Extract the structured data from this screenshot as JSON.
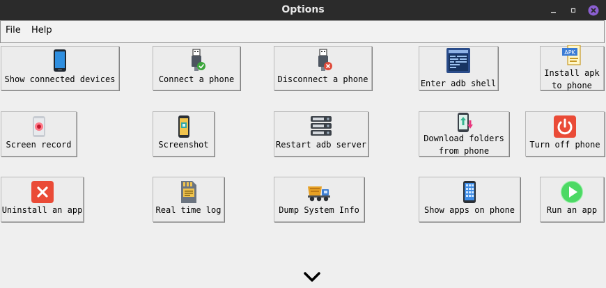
{
  "window": {
    "title": "Options"
  },
  "menubar": {
    "items": [
      "File",
      "Help"
    ]
  },
  "buttons": {
    "show_devices": "Show connected devices",
    "connect_phone": "Connect a phone",
    "disconnect_phone": "Disconnect a phone",
    "adb_shell": "Enter adb shell",
    "install_apk": "Install apk\nto phone",
    "screen_record": "Screen record",
    "screenshot": "Screenshot",
    "restart_adb": "Restart adb server",
    "download_folders": "Download folders\nfrom phone",
    "turn_off": "Turn off phone",
    "uninstall_app": "Uninstall an app",
    "realtime_log": "Real time log",
    "dump_info": "Dump System Info",
    "show_apps": "Show apps on phone",
    "run_app": "Run an app"
  },
  "icons": {
    "show_devices": "smartphone-icon",
    "connect_phone": "usb-connect-icon",
    "disconnect_phone": "usb-disconnect-icon",
    "adb_shell": "terminal-icon",
    "install_apk": "apk-file-icon",
    "screen_record": "record-icon",
    "screenshot": "screenshot-icon",
    "restart_adb": "server-icon",
    "download_folders": "download-phone-icon",
    "turn_off": "power-icon",
    "uninstall_app": "close-icon",
    "realtime_log": "log-sdcard-icon",
    "dump_info": "dump-truck-icon",
    "show_apps": "apps-grid-icon",
    "run_app": "play-icon"
  },
  "expand": {
    "icon": "chevron-down-icon"
  },
  "colors": {
    "titlebar": "#2b2b2b",
    "close_accent": "#8b5fd1",
    "button_bg": "#ececec",
    "window_bg": "#efefef"
  }
}
